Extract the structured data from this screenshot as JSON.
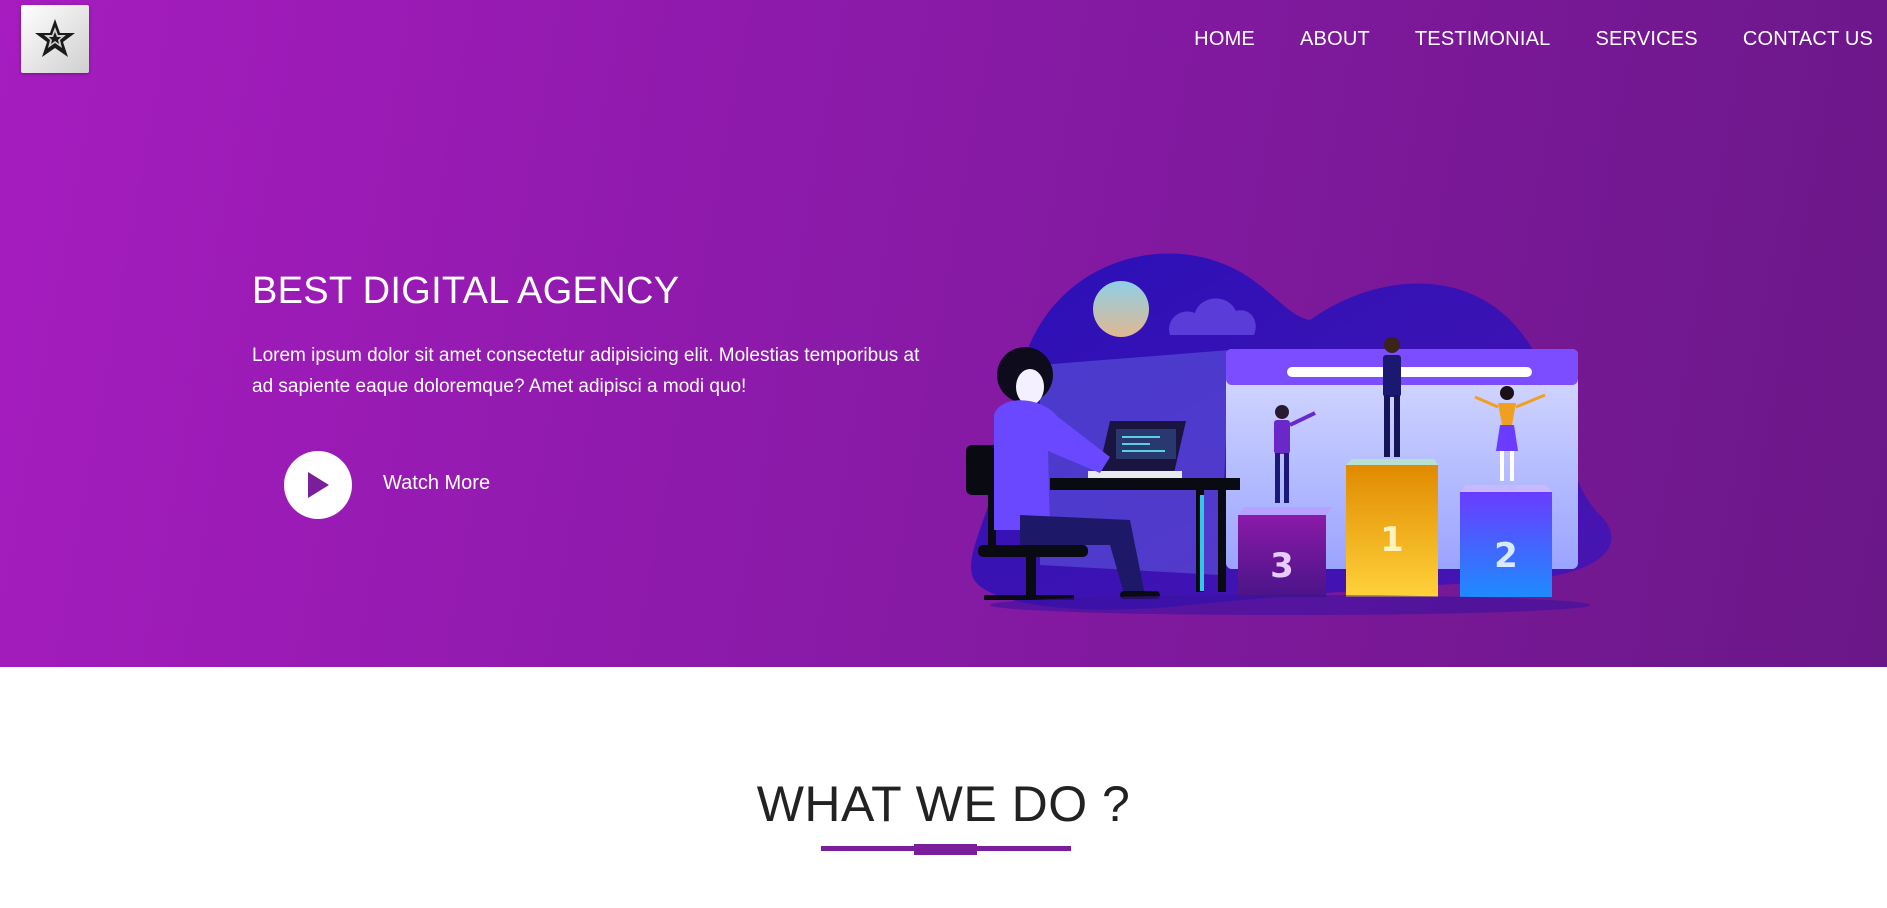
{
  "brand": {
    "logo_icon": "star-logo-icon"
  },
  "nav": {
    "items": [
      "HOME",
      "ABOUT",
      "TESTIMONIAL",
      "SERVICES",
      "CONTACT US"
    ]
  },
  "hero": {
    "title": "BEST DIGITAL AGENCY",
    "description": "Lorem ipsum dolor sit amet consectetur adipisicing elit. Molestias temporibus at ad sapiente eaque doloremque? Amet adipisci a modi quo!",
    "watch_label": "Watch More",
    "play_icon": "play-icon",
    "podium_labels": [
      "3",
      "1",
      "2"
    ]
  },
  "section": {
    "title": "WHAT WE DO ?"
  },
  "colors": {
    "hero_start": "#a61cbf",
    "hero_end": "#6a1788",
    "accent": "#7a1e9c"
  }
}
